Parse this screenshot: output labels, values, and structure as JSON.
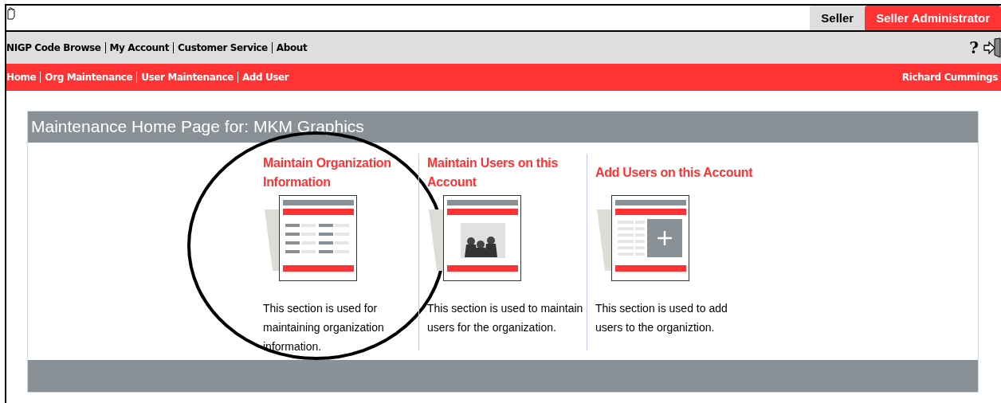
{
  "role_tabs": [
    {
      "label": "Seller",
      "selected": false
    },
    {
      "label": "Seller Administrator",
      "selected": true
    }
  ],
  "top_nav": [
    "NIGP Code Browse",
    "My Account",
    "Customer Service",
    "About"
  ],
  "help": "?",
  "sub_nav": [
    "Home",
    "Org Maintenance",
    "User Maintenance",
    "Add User"
  ],
  "user_name": "Richard Cummings",
  "panel": {
    "title": "Maintenance Home Page for: MKM Graphics",
    "sections": [
      {
        "title": "Maintain Organization Information",
        "kind": "form",
        "description": "This section is used for maintaining organization information.",
        "circled": true
      },
      {
        "title": "Maintain Users on this Account",
        "kind": "people",
        "description": "This section is used to maintain users for the organization.",
        "circled": false
      },
      {
        "title": "Add Users on this Account",
        "kind": "add",
        "description": "This section is used to add users to the organiztion.",
        "circled": false
      }
    ]
  }
}
